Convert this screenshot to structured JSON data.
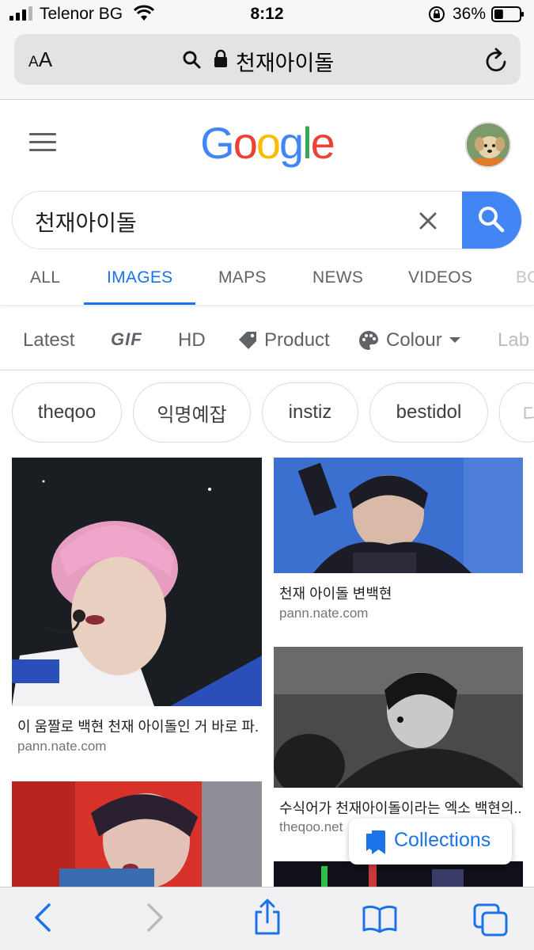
{
  "status_bar": {
    "carrier": "Telenor BG",
    "time": "8:12",
    "battery_percent": "36%",
    "battery_level": 0.36
  },
  "browser": {
    "text_size_label_small": "A",
    "text_size_label_large": "A",
    "address": "천재아이돌"
  },
  "google": {
    "logo_letters": [
      "G",
      "o",
      "o",
      "g",
      "l",
      "e"
    ],
    "logo_colors": [
      "#4285f4",
      "#ea4335",
      "#fbbc05",
      "#4285f4",
      "#34a853",
      "#ea4335"
    ],
    "search_query": "천재아이돌",
    "accent_color": "#1a73e8"
  },
  "tabs": [
    {
      "label": "ALL"
    },
    {
      "label": "IMAGES"
    },
    {
      "label": "MAPS"
    },
    {
      "label": "NEWS"
    },
    {
      "label": "VIDEOS"
    },
    {
      "label": "BO"
    }
  ],
  "filters": [
    {
      "label": "Latest"
    },
    {
      "label": "GIF"
    },
    {
      "label": "HD"
    },
    {
      "label": "Product",
      "icon": "tag-icon"
    },
    {
      "label": "Colour",
      "icon": "palette-icon"
    },
    {
      "label": "Lab"
    }
  ],
  "related_searches": [
    {
      "label": "theqoo"
    },
    {
      "label": "익명예잡"
    },
    {
      "label": "instiz"
    },
    {
      "label": "bestidol"
    },
    {
      "label": "디"
    }
  ],
  "results": [
    {
      "title": "이 움짤로 백현 천재 아이돌인 거 바로 파...",
      "source": "pann.nate.com"
    },
    {
      "title": "천재 아이돌 변백현",
      "source": "pann.nate.com"
    },
    {
      "title": "수식어가 천재아이돌이라는 엑소 백현의...",
      "source": "theqoo.net"
    },
    {
      "title": "",
      "source": ""
    },
    {
      "title": "",
      "source": ""
    }
  ],
  "collections": {
    "label": "Collections"
  },
  "toolbar": {
    "back": "chevron-left-icon",
    "forward": "chevron-right-icon",
    "share": "share-icon",
    "bookmarks": "book-icon",
    "tabs": "tabs-icon"
  }
}
